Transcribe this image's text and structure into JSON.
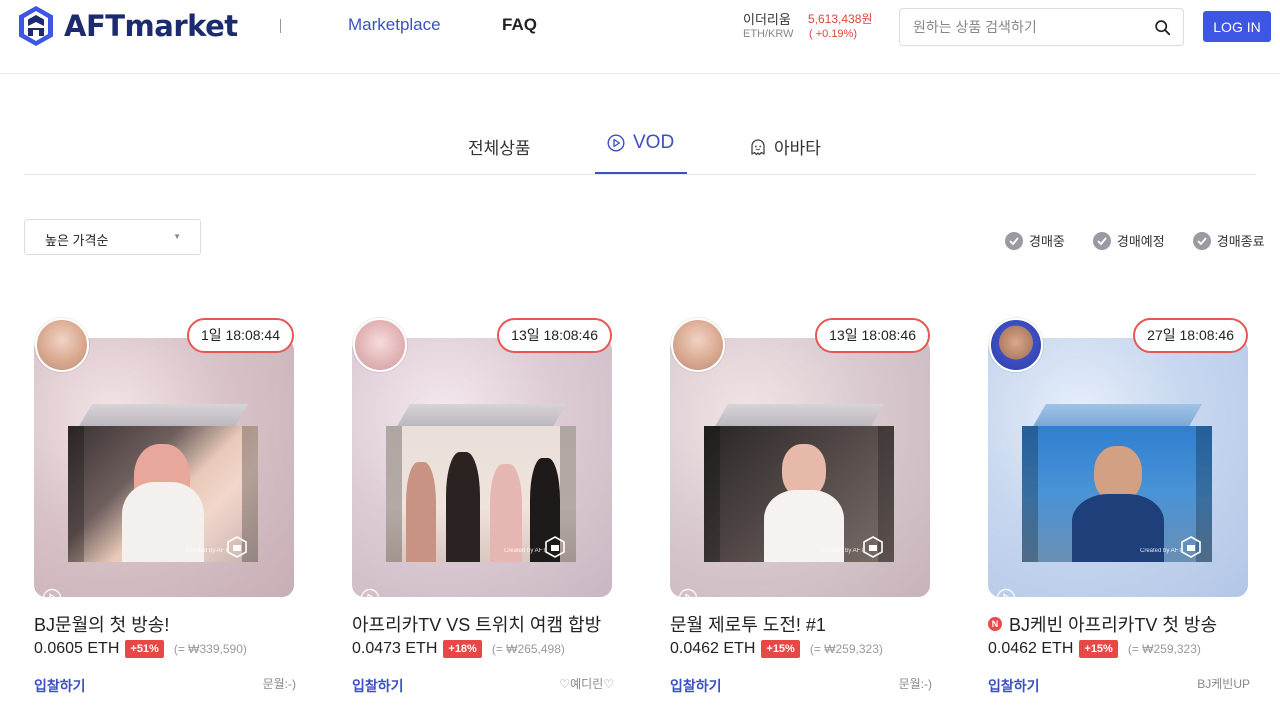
{
  "header": {
    "logo_text": "AFTmarket",
    "nav": {
      "marketplace": "Marketplace",
      "faq": "FAQ"
    },
    "ticker": {
      "name": "이더리움",
      "unit": "ETH/KRW",
      "price": "5,613,438원",
      "change": "( +0.19%)"
    },
    "search": {
      "placeholder": "원하는 상품 검색하기",
      "value": ""
    },
    "login_label": "LOG IN"
  },
  "tabs": [
    {
      "label": "전체상품",
      "active": false
    },
    {
      "label": "VOD",
      "active": true,
      "icon": "play-circle-icon"
    },
    {
      "label": "아바타",
      "active": false,
      "icon": "avatar-ghost-icon"
    }
  ],
  "filters": {
    "sort": {
      "selected": "높은 가격순"
    },
    "status": [
      "경매중",
      "경매예정",
      "경매종료"
    ]
  },
  "colors": {
    "accent": "#3c4fc3",
    "button": "#3d56e3",
    "hot": "#e84745",
    "timer_border": "#ea5553"
  },
  "cards": [
    {
      "timer": "1일 18:08:44",
      "title": "BJ문월의 첫 방송!",
      "eth": "0.0605 ETH",
      "pct": "+51%",
      "krw": "(= ₩339,590)",
      "bid": "입찰하기",
      "owner": "문월:-)",
      "live": false
    },
    {
      "timer": "13일 18:08:46",
      "title": "아프리카TV VS 트위치 여캠 합방",
      "eth": "0.0473 ETH",
      "pct": "+18%",
      "krw": "(= ₩265,498)",
      "bid": "입찰하기",
      "owner": "♡예디린♡",
      "live": false
    },
    {
      "timer": "13일 18:08:46",
      "title": "문월 제로투 도전! #1",
      "eth": "0.0462 ETH",
      "pct": "+15%",
      "krw": "(= ₩259,323)",
      "bid": "입찰하기",
      "owner": "문월:-)",
      "live": false
    },
    {
      "timer": "27일 18:08:46",
      "title": "BJ케빈 아프리카TV 첫 방송",
      "eth": "0.0462 ETH",
      "pct": "+15%",
      "krw": "(= ₩259,323)",
      "bid": "입찰하기",
      "owner": "BJ케빈UP",
      "live": true,
      "live_badge": "N"
    }
  ],
  "box_caption": "Created by AFT"
}
